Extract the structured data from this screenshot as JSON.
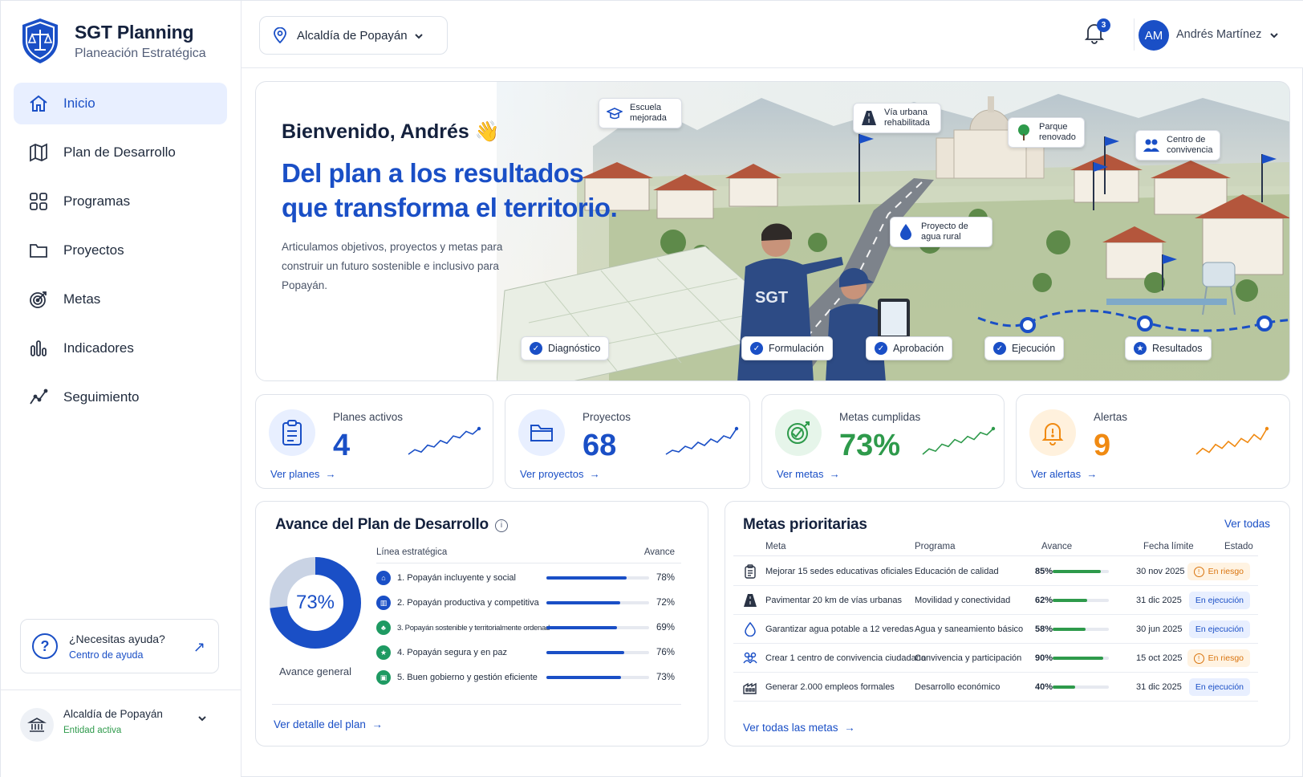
{
  "brand": {
    "title": "SGT Planning",
    "subtitle": "Planeación Estratégica"
  },
  "nav": [
    {
      "label": "Inicio",
      "icon": "home-icon",
      "active": true
    },
    {
      "label": "Plan de Desarrollo",
      "icon": "map-icon"
    },
    {
      "label": "Programas",
      "icon": "grid-icon"
    },
    {
      "label": "Proyectos",
      "icon": "folder-icon"
    },
    {
      "label": "Metas",
      "icon": "target-icon"
    },
    {
      "label": "Indicadores",
      "icon": "bar-chart-icon"
    },
    {
      "label": "Seguimiento",
      "icon": "trend-icon"
    }
  ],
  "help": {
    "title": "¿Necesitas ayuda?",
    "link": "Centro de ayuda"
  },
  "entity": {
    "name": "Alcaldía de Popayán",
    "status": "Entidad activa"
  },
  "topbar": {
    "org": "Alcaldía de Popayán",
    "notifications": "3",
    "user_initials": "AM",
    "user_name": "Andrés Martínez"
  },
  "hero": {
    "greeting": "Bienvenido, Andrés 👋",
    "title": "Del plan a los resultados que transforma el territorio.",
    "description": "Articulamos objetivos, proyectos y metas para construir un futuro sostenible e inclusivo para Popayán.",
    "tags": {
      "escuela": "Escuela mejorada",
      "via": "Vía urbana rehabilitada",
      "parque": "Parque renovado",
      "centro": "Centro de convivencia",
      "agua": "Proyecto de agua rural"
    },
    "stages": {
      "diagnostico": "Diagnóstico",
      "formulacion": "Formulación",
      "aprobacion": "Aprobación",
      "ejecucion": "Ejecución",
      "resultados": "Resultados"
    }
  },
  "kpis": [
    {
      "label": "Planes activos",
      "value": "4",
      "link": "Ver planes",
      "color": "#1a4fc6",
      "spark": [
        3,
        4,
        3.5,
        5,
        4.6,
        6,
        5.4,
        7,
        6.6,
        8,
        7.4,
        8.6
      ]
    },
    {
      "label": "Proyectos",
      "value": "68",
      "link": "Ver proyectos",
      "color": "#1a4fc6",
      "spark": [
        2,
        3,
        2.6,
        4,
        3.4,
        5,
        4.2,
        5.8,
        5,
        6.6,
        6,
        8.4
      ]
    },
    {
      "label": "Metas cumplidas",
      "value": "73%",
      "link": "Ver metas",
      "color": "#2e9a4b",
      "spark": [
        2,
        3.4,
        2.8,
        4.6,
        4,
        5.8,
        5,
        6.6,
        5.8,
        7.6,
        7,
        8.6
      ]
    },
    {
      "label": "Alertas",
      "value": "9",
      "link": "Ver alertas",
      "color": "#f08a12",
      "spark": [
        3,
        4.2,
        3.4,
        5,
        4.2,
        5.6,
        4.6,
        6.2,
        5.4,
        7,
        6,
        8.2
      ]
    }
  ],
  "plan": {
    "title": "Avance del Plan de Desarrollo",
    "general_value": "73%",
    "general_fraction": 0.73,
    "general_label": "Avance general",
    "col_line": "Línea estratégica",
    "col_avance": "Avance",
    "lines": [
      {
        "icon": "people-icon",
        "name": "1. Popayán incluyente y social",
        "pct": "78%",
        "value": 0.78
      },
      {
        "icon": "factory-icon",
        "name": "2. Popayán productiva y competitiva",
        "pct": "72%",
        "value": 0.72
      },
      {
        "icon": "leaf-icon",
        "name": "3. Popayán sostenible y territorialmente ordenada",
        "pct": "69%",
        "value": 0.69
      },
      {
        "icon": "shield-icon",
        "name": "4. Popayán segura y en paz",
        "pct": "76%",
        "value": 0.76
      },
      {
        "icon": "building-icon",
        "name": "5. Buen gobierno y gestión eficiente",
        "pct": "73%",
        "value": 0.73
      }
    ],
    "link": "Ver detalle del plan"
  },
  "metas": {
    "title": "Metas prioritarias",
    "view_all": "Ver todas",
    "columns": {
      "meta": "Meta",
      "programa": "Programa",
      "avance": "Avance",
      "fecha": "Fecha límite",
      "estado": "Estado"
    },
    "rows": [
      {
        "icon": "clipboard-icon",
        "meta": "Mejorar 15 sedes educativas oficiales",
        "programa": "Educación de calidad",
        "avance": "85%",
        "value": 0.85,
        "fecha": "30 nov 2025",
        "estado": "En riesgo",
        "risk": true
      },
      {
        "icon": "road-icon",
        "meta": "Pavimentar 20 km de vías urbanas",
        "programa": "Movilidad y conectividad",
        "avance": "62%",
        "value": 0.62,
        "fecha": "31 dic 2025",
        "estado": "En ejecución",
        "risk": false
      },
      {
        "icon": "water-drop-icon",
        "meta": "Garantizar agua potable a 12 veredas",
        "programa": "Agua y saneamiento básico",
        "avance": "58%",
        "value": 0.58,
        "fecha": "30 jun 2025",
        "estado": "En ejecución",
        "risk": false
      },
      {
        "icon": "community-icon",
        "meta": "Crear 1 centro de convivencia ciudadana",
        "programa": "Convivencia y participación",
        "avance": "90%",
        "value": 0.9,
        "fecha": "15 oct 2025",
        "estado": "En riesgo",
        "risk": true
      },
      {
        "icon": "factory-icon",
        "meta": "Generar 2.000 empleos formales",
        "programa": "Desarrollo económico",
        "avance": "40%",
        "value": 0.4,
        "fecha": "31 dic 2025",
        "estado": "En ejecución",
        "risk": false
      }
    ],
    "link": "Ver todas las metas"
  }
}
